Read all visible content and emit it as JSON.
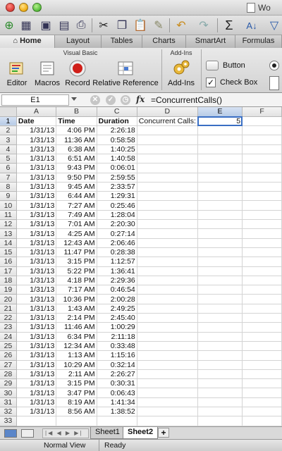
{
  "window": {
    "title": "Wo"
  },
  "tabs": [
    "Home",
    "Layout",
    "Tables",
    "Charts",
    "SmartArt",
    "Formulas"
  ],
  "ribbon": {
    "group_visual_basic": "Visual Basic",
    "group_addins": "Add-Ins",
    "buttons": {
      "editor": "Editor",
      "macros": "Macros",
      "record": "Record",
      "relative": "Relative Reference",
      "addins": "Add-Ins"
    },
    "form_controls": {
      "button": "Button",
      "checkbox": "Check Box"
    }
  },
  "formula_bar": {
    "name_box": "E1",
    "fx": "fx",
    "formula": "=ConcurrentCalls()"
  },
  "columns": [
    "A",
    "B",
    "C",
    "D",
    "E",
    "F"
  ],
  "headers": {
    "a": "Date",
    "b": "Time",
    "c": "Duration"
  },
  "summary": {
    "label": "Concurrent Calls:",
    "value": "5"
  },
  "rows": [
    [
      "1/31/13",
      "4:06 PM",
      "2:26:18"
    ],
    [
      "1/31/13",
      "11:36 AM",
      "0:58:58"
    ],
    [
      "1/31/13",
      "6:38 AM",
      "1:40:25"
    ],
    [
      "1/31/13",
      "6:51 AM",
      "1:40:58"
    ],
    [
      "1/31/13",
      "9:43 PM",
      "0:06:01"
    ],
    [
      "1/31/13",
      "9:50 PM",
      "2:59:55"
    ],
    [
      "1/31/13",
      "9:45 AM",
      "2:33:57"
    ],
    [
      "1/31/13",
      "6:44 AM",
      "1:29:31"
    ],
    [
      "1/31/13",
      "7:27 AM",
      "0:25:46"
    ],
    [
      "1/31/13",
      "7:49 AM",
      "1:28:04"
    ],
    [
      "1/31/13",
      "7:01 AM",
      "2:20:30"
    ],
    [
      "1/31/13",
      "4:25 AM",
      "0:27:14"
    ],
    [
      "1/31/13",
      "12:43 AM",
      "2:06:46"
    ],
    [
      "1/31/13",
      "11:47 PM",
      "0:28:38"
    ],
    [
      "1/31/13",
      "3:15 PM",
      "1:12:57"
    ],
    [
      "1/31/13",
      "5:22 PM",
      "1:36:41"
    ],
    [
      "1/31/13",
      "4:18 PM",
      "2:29:36"
    ],
    [
      "1/31/13",
      "7:17 AM",
      "0:46:54"
    ],
    [
      "1/31/13",
      "10:36 PM",
      "2:00:28"
    ],
    [
      "1/31/13",
      "1:43 AM",
      "2:49:25"
    ],
    [
      "1/31/13",
      "2:14 PM",
      "2:45:40"
    ],
    [
      "1/31/13",
      "11:46 AM",
      "1:00:29"
    ],
    [
      "1/31/13",
      "6:34 PM",
      "2:11:18"
    ],
    [
      "1/31/13",
      "12:34 AM",
      "0:33:48"
    ],
    [
      "1/31/13",
      "1:13 AM",
      "1:15:16"
    ],
    [
      "1/31/13",
      "10:29 AM",
      "0:32:14"
    ],
    [
      "1/31/13",
      "2:11 AM",
      "2:26:27"
    ],
    [
      "1/31/13",
      "3:15 PM",
      "0:30:31"
    ],
    [
      "1/31/13",
      "3:47 PM",
      "0:06:43"
    ],
    [
      "1/31/13",
      "8:19 AM",
      "1:41:34"
    ],
    [
      "1/31/13",
      "8:56 AM",
      "1:38:52"
    ]
  ],
  "sheets": [
    "Sheet1",
    "Sheet2"
  ],
  "active_sheet": "Sheet2",
  "status": {
    "view": "Normal View",
    "state": "Ready"
  },
  "colors": {
    "selection": "#3a6fc4",
    "header_selected": "#b7cbe6"
  }
}
